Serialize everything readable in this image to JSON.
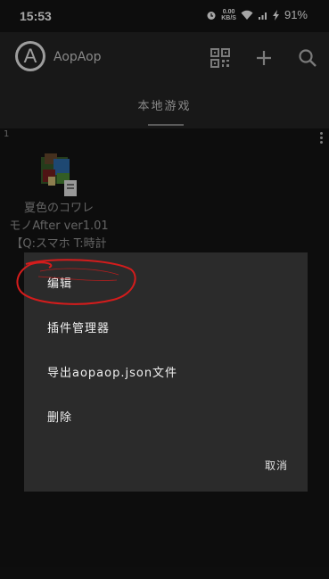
{
  "status": {
    "time": "15:53",
    "speed_value": "0.00",
    "speed_unit": "KB/S",
    "battery": "91%"
  },
  "app": {
    "title": "AopAop",
    "logo_letter": "A"
  },
  "tabs": [
    {
      "label": "本地游戏"
    }
  ],
  "list": {
    "count": "1",
    "item": {
      "title_line1": "夏色のコワレ",
      "title_line2": "モノAfter ver1.01",
      "title_line3": "【Q:スマホ T:時計"
    }
  },
  "dialog": {
    "items": [
      {
        "label": "编辑"
      },
      {
        "label": "插件管理器"
      },
      {
        "label": "导出aopaop.json文件"
      },
      {
        "label": "删除"
      }
    ],
    "cancel_label": "取消"
  },
  "colors": {
    "appbar": "#262626",
    "background": "#151515",
    "dialog": "#2b2b2b",
    "annotation": "#d41c1c"
  }
}
